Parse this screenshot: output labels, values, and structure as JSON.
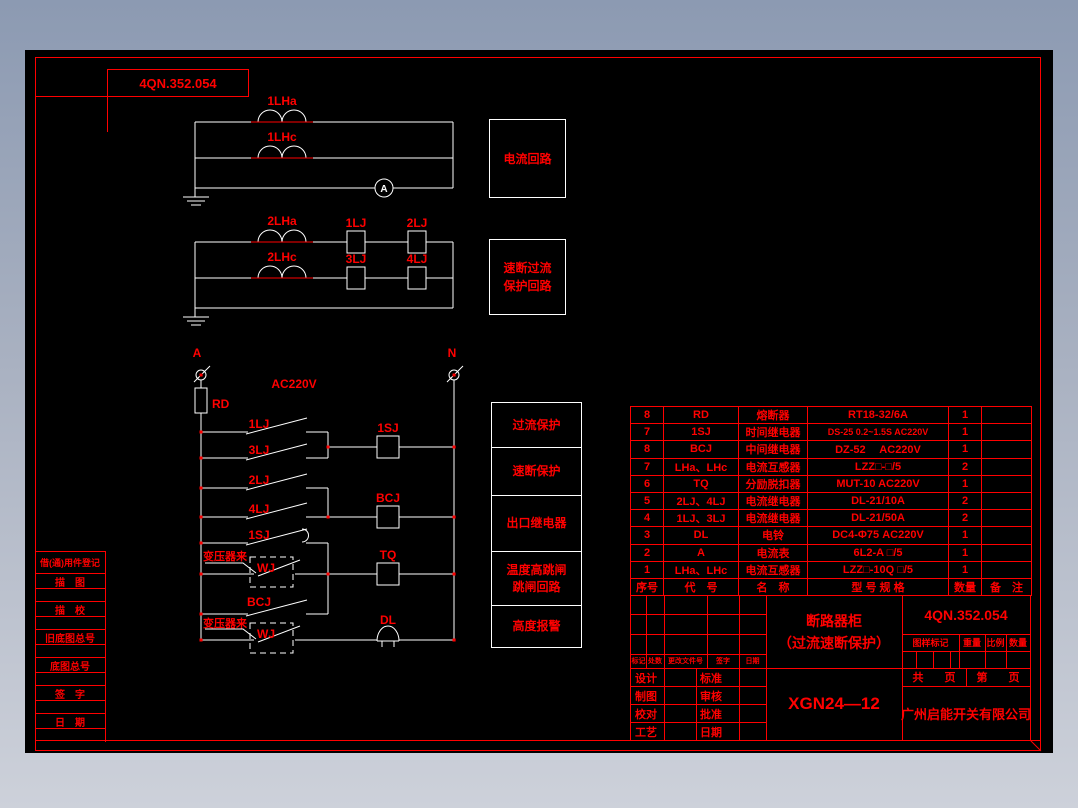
{
  "frame": {
    "code_box": "4QN.352.054"
  },
  "current_circuit": {
    "ct_a": "1LHa",
    "ct_c": "1LHc",
    "ammeter": "A",
    "box": "电流回路"
  },
  "quick_break_circuit": {
    "ct_a": "2LHa",
    "ct_c": "2LHc",
    "relay1": "1LJ",
    "relay2": "2LJ",
    "relay3": "3LJ",
    "relay4": "4LJ",
    "box_line1": "速断过流",
    "box_line2": "保护回路"
  },
  "control_circuit": {
    "phase_a": "A",
    "phase_n": "N",
    "voltage": "AC220V",
    "fuse": "RD",
    "contact_1lj": "1LJ",
    "contact_3lj": "3LJ",
    "coil_1sj": "1SJ",
    "contact_2lj": "2LJ",
    "contact_4lj": "4LJ",
    "coil_bcj": "BCJ",
    "contact_1sj": "1SJ",
    "contact_wj1": "WJ",
    "contact_bcj": "BCJ",
    "coil_tq": "TQ",
    "contact_wj2": "WJ",
    "bell_dl": "DL",
    "from_transformer1": "变压器来",
    "from_transformer2": "变压器来"
  },
  "function_boxes": {
    "f1": "过流保护",
    "f2": "速断保护",
    "f3": "出口继电器",
    "f4_line1": "温度高跳闸",
    "f4_line2": "跳闸回路",
    "f5": "高度报警"
  },
  "parts_table": {
    "headers": {
      "seq": "序号",
      "code": "代　号",
      "name": "名　称",
      "model": "型 号 规 格",
      "qty": "数量",
      "notes": "备　注"
    },
    "rows": [
      {
        "seq": "8",
        "code": "RD",
        "name": "熔断器",
        "model": "RT18-32/6A",
        "qty": "1",
        "notes": ""
      },
      {
        "seq": "7",
        "code": "1SJ",
        "name": "时间继电器",
        "model": "DS-25 0.2~1.5S AC220V",
        "qty": "1",
        "notes": ""
      },
      {
        "seq": "8",
        "code": "BCJ",
        "name": "中间继电器",
        "model": "DZ-52　 AC220V",
        "qty": "1",
        "notes": ""
      },
      {
        "seq": "7",
        "code": "LHa、LHc",
        "name": "电流互感器",
        "model": "LZZ□-□/5",
        "qty": "2",
        "notes": ""
      },
      {
        "seq": "6",
        "code": "TQ",
        "name": "分励脱扣器",
        "model": "MUT-10 AC220V",
        "qty": "1",
        "notes": ""
      },
      {
        "seq": "5",
        "code": "2LJ、4LJ",
        "name": "电流继电器",
        "model": "DL-21/10A",
        "qty": "2",
        "notes": ""
      },
      {
        "seq": "4",
        "code": "1LJ、3LJ",
        "name": "电流继电器",
        "model": "DL-21/50A",
        "qty": "2",
        "notes": ""
      },
      {
        "seq": "3",
        "code": "DL",
        "name": "电铃",
        "model": "DC4-Φ75 AC220V",
        "qty": "1",
        "notes": ""
      },
      {
        "seq": "2",
        "code": "A",
        "name": "电流表",
        "model": "6L2-A □/5",
        "qty": "1",
        "notes": ""
      },
      {
        "seq": "1",
        "code": "LHa、LHc",
        "name": "电流互感器",
        "model": "LZZ□-10Q □/5",
        "qty": "1",
        "notes": ""
      }
    ]
  },
  "title_block": {
    "title_line1": "断路器柜",
    "title_line2": "（过流速断保护）",
    "drawing_code": "4QN.352.054",
    "model": "XGN24—12",
    "company": "广州启能开关有限公司",
    "revision": {
      "mark": "标记",
      "count": "处数",
      "file": "更改文件号",
      "sign": "签字",
      "date": "日期"
    },
    "staff": {
      "design": "设计",
      "standard": "标准",
      "draft": "制图",
      "review": "审核",
      "proof": "校对",
      "approve": "批准",
      "craft": "工艺",
      "date": "日期"
    },
    "marks": {
      "specimen": "图样标记",
      "weight": "重量",
      "scale": "比例",
      "qty": "数量"
    },
    "pages": {
      "gong": "共",
      "ye1": "页",
      "di": "第",
      "ye2": "页"
    }
  },
  "register_block": {
    "title": "借(通)用件登记",
    "r1": "描　图",
    "r2": "描　校",
    "r3": "旧底图总号",
    "r4": "底图总号",
    "r5": "签　字",
    "r6": "日　期"
  }
}
